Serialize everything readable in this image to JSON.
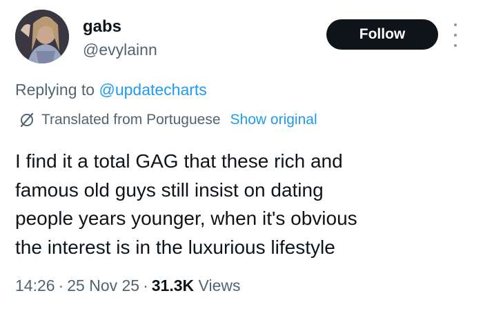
{
  "user": {
    "display_name": "gabs",
    "handle": "@evylainn"
  },
  "actions": {
    "follow_label": "Follow"
  },
  "reply": {
    "prefix": "Replying to",
    "mention": "@updatecharts"
  },
  "translation": {
    "label": "Translated from Portuguese",
    "show_original_label": "Show original"
  },
  "tweet": {
    "lines": [
      "I find it a total GAG that these rich and",
      "famous old guys still insist on dating",
      "people years younger, when it's obvious",
      "the interest is in the luxurious lifestyle"
    ]
  },
  "meta": {
    "time": "14:26",
    "date": "25 Nov 25",
    "views_count": "31.3K",
    "views_label": "Views",
    "separator": "·"
  },
  "colors": {
    "accent": "#1d9bf0",
    "muted": "#536471",
    "text": "#0f1419",
    "button_bg": "#0f1419"
  },
  "icons": {
    "more": "more-dots-vertical-icon",
    "translate": "translate-slash-icon"
  }
}
